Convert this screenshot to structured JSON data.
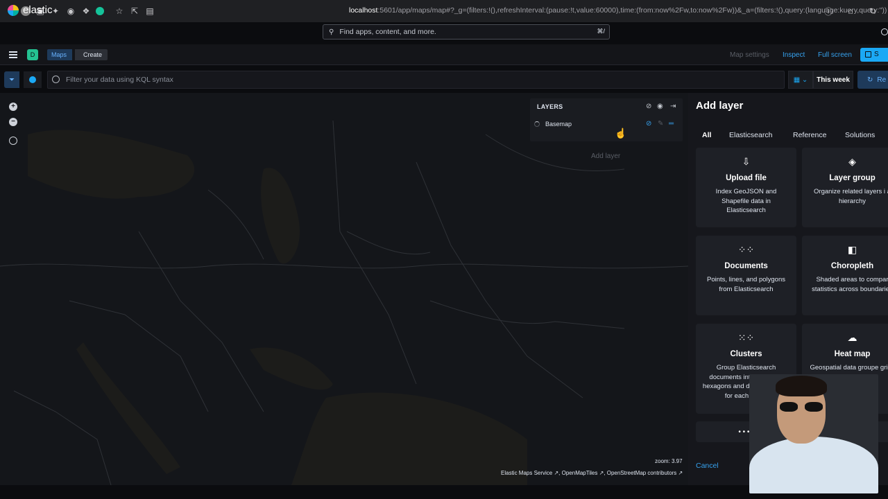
{
  "browser": {
    "url_host": "localhost",
    "url_rest": ":5601/app/maps/map#?_g=(filters:!(),refreshInterval:(pause:!t,value:60000),time:(from:now%2Fw,to:now%2Fw))&_a=(filters:!(),query:(language:kuery,query:''))"
  },
  "header": {
    "brand": "elastic",
    "search_placeholder": "Find apps, content, and more.",
    "search_shortcut": "⌘/"
  },
  "nav": {
    "space_initial": "D",
    "breadcrumbs": [
      "Maps",
      "Create"
    ],
    "map_settings": "Map settings",
    "inspect": "Inspect",
    "full_screen": "Full screen",
    "save": "S"
  },
  "query": {
    "placeholder": "Filter your data using KQL syntax",
    "date_range": "This week",
    "refresh": "Re"
  },
  "layers": {
    "title": "LAYERS",
    "items": [
      {
        "name": "Basemap"
      }
    ],
    "add_layer": "Add layer"
  },
  "map": {
    "zoom_text": "zoom: 3.97",
    "attribution": [
      "Elastic Maps Service",
      "OpenMapTiles",
      "OpenStreetMap contributors"
    ]
  },
  "flyout": {
    "title": "Add layer",
    "tabs": [
      "All",
      "Elasticsearch",
      "Reference",
      "Solutions"
    ],
    "cards": [
      {
        "title": "Upload file",
        "desc": "Index GeoJSON and Shapefile data in Elasticsearch",
        "icon": "upload-icon"
      },
      {
        "title": "Layer group",
        "desc": "Organize related layers i a hierarchy",
        "icon": "layers-icon"
      },
      {
        "title": "Documents",
        "desc": "Points, lines, and polygons from Elasticsearch",
        "icon": "documents-icon"
      },
      {
        "title": "Choropleth",
        "desc": "Shaded areas to compar statistics across boundaries",
        "icon": "choropleth-icon"
      },
      {
        "title": "Clusters",
        "desc": "Group Elasticsearch documents into grids and hexagons and display metrics for each group",
        "icon": "clusters-icon"
      },
      {
        "title": "Heat map",
        "desc": "Geospatial data groupe grids to show density",
        "icon": "heatmap-icon"
      }
    ],
    "cancel": "Cancel"
  }
}
